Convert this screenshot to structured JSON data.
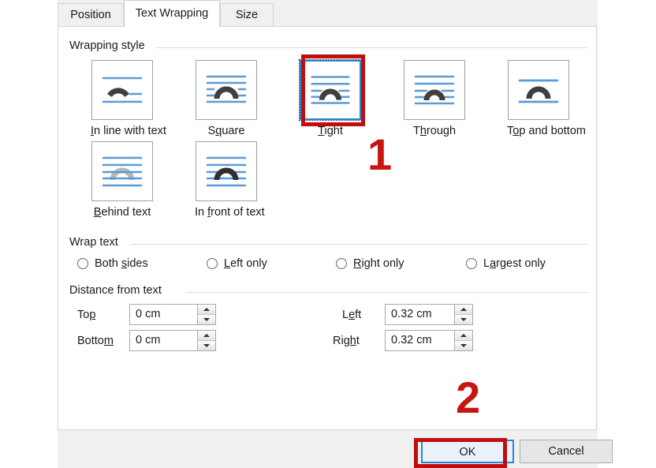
{
  "dialog": {
    "tabs": [
      {
        "id": "position",
        "label": "Position",
        "active": false
      },
      {
        "id": "text-wrapping",
        "label": "Text Wrapping",
        "active": true
      },
      {
        "id": "size",
        "label": "Size",
        "active": false
      }
    ],
    "groups": {
      "wrapping_style": "Wrapping style",
      "wrap_text": "Wrap text",
      "distance_from_text": "Distance from text"
    },
    "wrapping_styles": [
      {
        "id": "in-line-with-text",
        "label": "In line with text",
        "accel": "I",
        "selected": false,
        "icon": "wrap-inline-icon"
      },
      {
        "id": "square",
        "label": "Square",
        "accel": "q",
        "selected": false,
        "icon": "wrap-square-icon"
      },
      {
        "id": "tight",
        "label": "Tight",
        "accel": "T",
        "selected": true,
        "icon": "wrap-tight-icon"
      },
      {
        "id": "through",
        "label": "Through",
        "accel": "h",
        "selected": false,
        "icon": "wrap-through-icon"
      },
      {
        "id": "top-and-bottom",
        "label": "Top and bottom",
        "accel": "o",
        "selected": false,
        "icon": "wrap-topbottom-icon"
      },
      {
        "id": "behind-text",
        "label": "Behind text",
        "accel": "B",
        "selected": false,
        "icon": "wrap-behind-icon"
      },
      {
        "id": "in-front-of-text",
        "label": "In front of text",
        "accel": "f",
        "selected": false,
        "icon": "wrap-infront-icon"
      }
    ],
    "wrap_text_options": [
      {
        "id": "both-sides",
        "label": "Both sides",
        "accel": "s",
        "selected": false
      },
      {
        "id": "left-only",
        "label": "Left only",
        "accel": "L",
        "selected": false
      },
      {
        "id": "right-only",
        "label": "Right only",
        "accel": "R",
        "selected": false
      },
      {
        "id": "largest-only",
        "label": "Largest only",
        "accel": "a",
        "selected": false
      }
    ],
    "distance_fields": [
      {
        "id": "top",
        "label": "Top",
        "accel": "p",
        "value": "0 cm"
      },
      {
        "id": "bottom",
        "label": "Bottom",
        "accel": "m",
        "value": "0 cm"
      },
      {
        "id": "left",
        "label": "Left",
        "accel": "e",
        "value": "0.32 cm"
      },
      {
        "id": "right",
        "label": "Right",
        "accel": "t",
        "value": "0.32 cm"
      }
    ],
    "buttons": {
      "ok": "OK",
      "cancel": "Cancel"
    }
  },
  "annotations": {
    "step_one": "1",
    "step_two": "2",
    "highlight_color": "#c00d0d"
  }
}
